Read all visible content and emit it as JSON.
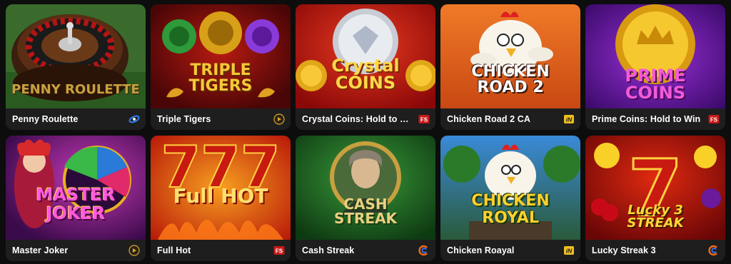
{
  "games": [
    {
      "name": "Penny Roulette",
      "art_title": "PENNY ROULETTE",
      "provider_icon": "tilted-ring-logo-icon",
      "accent": "#3b6b2a"
    },
    {
      "name": "Triple Tigers",
      "art_title": "TRIPLE TIGERS",
      "provider_icon": "play-badge-logo-icon",
      "accent": "#8a1010"
    },
    {
      "name": "Crystal Coins: Hold to Win",
      "art_title": "Crystal COINS",
      "provider_icon": "fs-badge-logo-icon",
      "accent": "#c81818"
    },
    {
      "name": "Chicken Road 2 CA",
      "art_title": "CHICKEN ROAD 2",
      "provider_icon": "in-badge-logo-icon",
      "accent": "#e05a1a"
    },
    {
      "name": "Prime Coins: Hold to Win",
      "art_title": "PRIME COINS",
      "provider_icon": "fs-badge-logo-icon",
      "accent": "#6a1fa0"
    },
    {
      "name": "Master Joker",
      "art_title": "MASTER JOKER",
      "provider_icon": "play-badge-logo-icon",
      "accent": "#7a1a8a"
    },
    {
      "name": "Full Hot",
      "art_title": "Full HOT",
      "provider_icon": "fs-badge-logo-icon",
      "accent": "#d43010"
    },
    {
      "name": "Cash Streak",
      "art_title": "CASH STREAK",
      "provider_icon": "e-swirl-logo-icon",
      "accent": "#1f6a2a"
    },
    {
      "name": "Chicken Roayal",
      "art_title": "CHICKEN ROYAL",
      "provider_icon": "in-badge-logo-icon",
      "accent": "#2a6a9a"
    },
    {
      "name": "Lucky Streak 3",
      "art_title": "Lucky 3 STREAK",
      "provider_icon": "e-swirl-logo-icon",
      "accent": "#b81010"
    }
  ]
}
